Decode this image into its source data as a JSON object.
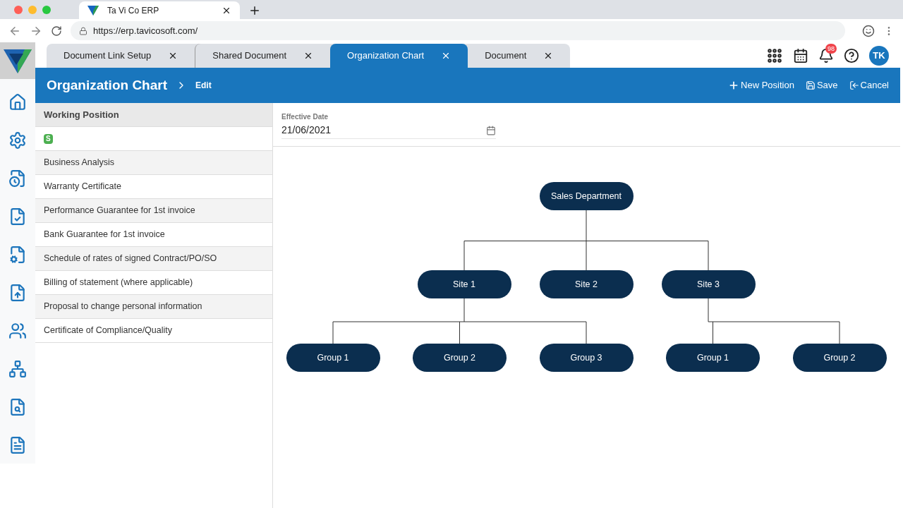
{
  "browser": {
    "tab_title": "Ta Vi Co ERP",
    "url": "https://erp.tavicosoft.com/"
  },
  "app_tabs": [
    {
      "label": "Document Link Setup",
      "selected": false
    },
    {
      "label": "Shared Document",
      "selected": false
    },
    {
      "label": "Organization Chart",
      "selected": true
    },
    {
      "label": "Document",
      "selected": false
    }
  ],
  "top_bar": {
    "notification_count": "98",
    "avatar": "TK"
  },
  "page_header": {
    "title": "Organization Chart",
    "breadcrumb": "Edit",
    "actions": [
      {
        "label": "New Position",
        "kind": "add"
      },
      {
        "label": "Save",
        "kind": "save"
      },
      {
        "label": "Cancel",
        "kind": "cancel"
      }
    ]
  },
  "working_positions": {
    "header": "Working Position",
    "badge": "S",
    "items": [
      "Business Analysis",
      "Warranty Certificate",
      "Performance Guarantee for 1st invoice",
      "Bank Guarantee for 1st invoice",
      "Schedule of rates of signed Contract/PO/SO",
      "Billing of statement (where applicable)",
      "Proposal to change personal information",
      "Certificate of Compliance/Quality"
    ]
  },
  "effective_date": {
    "label": "Effective Date",
    "value": "21/06/2021"
  },
  "org_chart": {
    "label": "Sales Department",
    "children": [
      {
        "label": "Site 1",
        "children": [
          {
            "label": "Group 1"
          },
          {
            "label": "Group 2"
          },
          {
            "label": "Group 3"
          }
        ]
      },
      {
        "label": "Site 2"
      },
      {
        "label": "Site 3",
        "children": [
          {
            "label": "Group 1"
          },
          {
            "label": "Group 2"
          }
        ]
      }
    ]
  }
}
